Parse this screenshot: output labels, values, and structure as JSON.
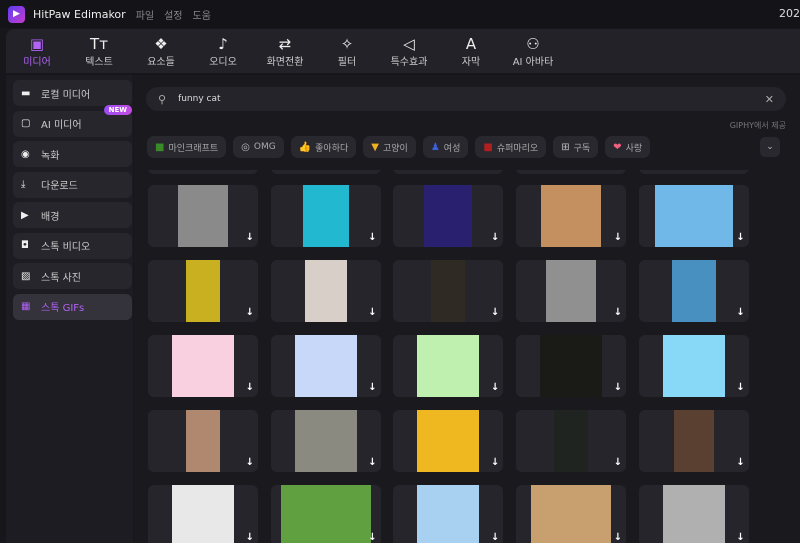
{
  "app": {
    "title": "HitPaw Edimakor",
    "menus": [
      "파일",
      "설정",
      "도움"
    ],
    "year": "202"
  },
  "toolbar": [
    {
      "label": "미디어",
      "icon": "media-icon",
      "glyph": "▣",
      "active": true
    },
    {
      "label": "텍스트",
      "icon": "text-icon",
      "glyph": "Tт"
    },
    {
      "label": "요소들",
      "icon": "elements-icon",
      "glyph": "❖"
    },
    {
      "label": "오디오",
      "icon": "music-note-icon",
      "glyph": "♪"
    },
    {
      "label": "화면전환",
      "icon": "transition-icon",
      "glyph": "⇄"
    },
    {
      "label": "필터",
      "icon": "sparkle-icon",
      "glyph": "✧"
    },
    {
      "label": "특수효과",
      "icon": "effects-icon",
      "glyph": "◁"
    },
    {
      "label": "자막",
      "icon": "subtitle-icon",
      "glyph": "A"
    },
    {
      "label": "AI 아바타",
      "icon": "avatar-icon",
      "glyph": "⚇"
    }
  ],
  "sidebar": [
    {
      "label": "로컬 미디어",
      "icon": "folder-icon",
      "glyph": "▬"
    },
    {
      "label": "AI 미디어",
      "icon": "ai-media-icon",
      "glyph": "▢",
      "badge": "NEW"
    },
    {
      "label": "녹화",
      "icon": "record-icon",
      "glyph": "◉"
    },
    {
      "label": "다운로드",
      "icon": "download-icon",
      "glyph": "⤓"
    },
    {
      "label": "배경",
      "icon": "play-icon",
      "glyph": "▶"
    },
    {
      "label": "스톡 비디오",
      "icon": "stock-video-icon",
      "glyph": "◘"
    },
    {
      "label": "스톡 사진",
      "icon": "stock-photo-icon",
      "glyph": "▨"
    },
    {
      "label": "스톡 GIFs",
      "icon": "gif-icon",
      "glyph": "▦",
      "active": true
    }
  ],
  "search": {
    "value": "funny cat",
    "placeholder": "검색"
  },
  "credit": "GIPHY에서 제공",
  "chips": [
    {
      "label": "마인크래프트",
      "icon": "creeper-icon",
      "glyph": "■",
      "color": "#3a8a2a"
    },
    {
      "label": "OMG",
      "icon": "omg-icon",
      "glyph": "◎",
      "color": "#bbb"
    },
    {
      "label": "좋아하다",
      "icon": "thumbs-up-icon",
      "glyph": "👍",
      "color": "#bbb"
    },
    {
      "label": "고양이",
      "icon": "cat-icon",
      "glyph": "▼",
      "color": "#f0b020"
    },
    {
      "label": "여성",
      "icon": "woman-icon",
      "glyph": "♟",
      "color": "#3a60e0"
    },
    {
      "label": "슈퍼마리오",
      "icon": "mario-icon",
      "glyph": "■",
      "color": "#b02020"
    },
    {
      "label": "구독",
      "icon": "bookmark-icon",
      "glyph": "⊞",
      "color": "#bbb"
    },
    {
      "label": "사랑",
      "icon": "heart-icon",
      "glyph": "❤",
      "color": "#f06080"
    }
  ],
  "gifs": [
    [
      "#8a8a8a",
      "#22b8d0",
      "#2a2070",
      "#c49060",
      "#70b8e8"
    ],
    [
      "#c8b020",
      "#d8d0c8",
      "#302a24",
      "#909090",
      "#4890c0"
    ],
    [
      "#f8d0e0",
      "#c8d8f8",
      "#c0f0b0",
      "#1a1a16",
      "#88d8f8"
    ],
    [
      "#b08870",
      "#8a8a80",
      "#f0b820",
      "#202420",
      "#5a4030"
    ],
    [
      "#e8e8e8",
      "#60a040",
      "#a8d0f0",
      "#c8a070",
      "#b0b0b0"
    ]
  ]
}
